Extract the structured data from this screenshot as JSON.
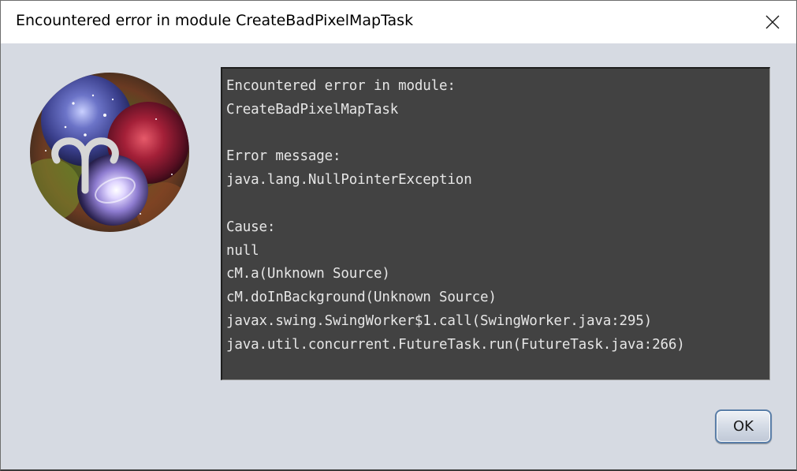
{
  "window": {
    "title": "Encountered error in module CreateBadPixelMapTask"
  },
  "console": {
    "lines": [
      "Encountered error in module:",
      "CreateBadPixelMapTask",
      "",
      "Error message:",
      "java.lang.NullPointerException",
      "",
      "Cause:",
      "null",
      "cM.a(Unknown Source)",
      "cM.doInBackground(Unknown Source)",
      "javax.swing.SwingWorker$1.call(SwingWorker.java:295)",
      "java.util.concurrent.FutureTask.run(FutureTask.java:266)"
    ]
  },
  "buttons": {
    "ok_label": "OK"
  },
  "icons": {
    "close": "close-icon",
    "logo": "app-logo-icon"
  },
  "colors": {
    "console_bg": "#424242",
    "console_text": "#e6e6e6",
    "dialog_bg": "#d6dae2",
    "button_border": "#5a7ea8"
  }
}
